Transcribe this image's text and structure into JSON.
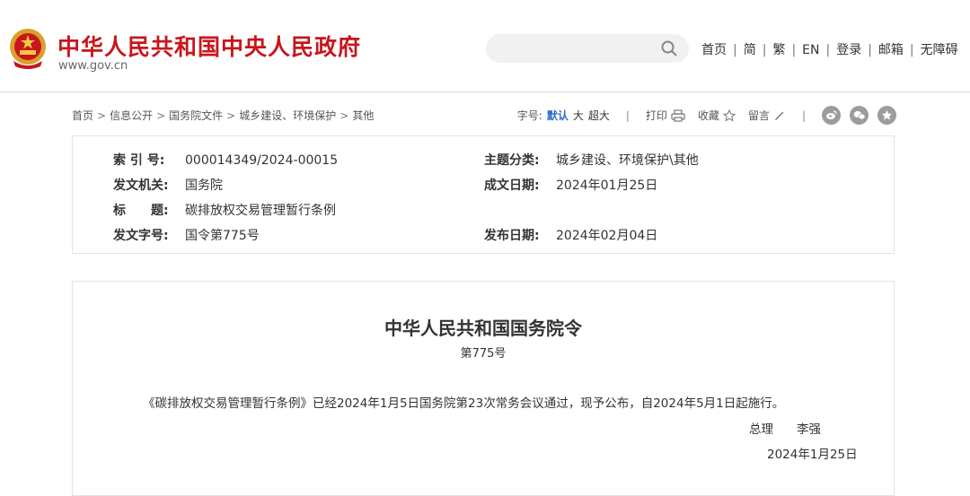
{
  "header": {
    "site_name": "中华人民共和国中央人民政府",
    "site_url": "www.gov.cn",
    "brand_color": "#c8161d",
    "search_placeholder": "",
    "nav": [
      "首页",
      "简",
      "繁",
      "EN",
      "登录",
      "邮箱",
      "无障碍"
    ]
  },
  "breadcrumb": [
    "首页",
    "信息公开",
    "国务院文件",
    "城乡建设、环境保护",
    "其他"
  ],
  "toolbar": {
    "font_size_label": "字号:",
    "font_sizes": [
      "默认",
      "大",
      "超大"
    ],
    "print": "打印",
    "favorite": "收藏",
    "comment": "留言",
    "share_icons": [
      "weibo-icon",
      "wechat-icon",
      "star-icon"
    ]
  },
  "metadata": {
    "index_no": {
      "label": "索 引 号:",
      "value": "000014349/2024-00015"
    },
    "topic": {
      "label": "主题分类:",
      "value": "城乡建设、环境保护\\其他"
    },
    "issuer": {
      "label": "发文机关:",
      "value": "国务院"
    },
    "written_date": {
      "label": "成文日期:",
      "value": "2024年01月25日"
    },
    "title": {
      "label": "标　　题:",
      "value": "碳排放权交易管理暂行条例"
    },
    "doc_no": {
      "label": "发文字号:",
      "value": "国令第775号"
    },
    "publish_date": {
      "label": "发布日期:",
      "value": "2024年02月04日"
    }
  },
  "document": {
    "title": "中华人民共和国国务院令",
    "number": "第775号",
    "body": "《碳排放权交易管理暂行条例》已经2024年1月5日国务院第23次常务会议通过，现予公布，自2024年5月1日起施行。",
    "signer_role": "总理",
    "signer_name": "李强",
    "date": "2024年1月25日"
  }
}
